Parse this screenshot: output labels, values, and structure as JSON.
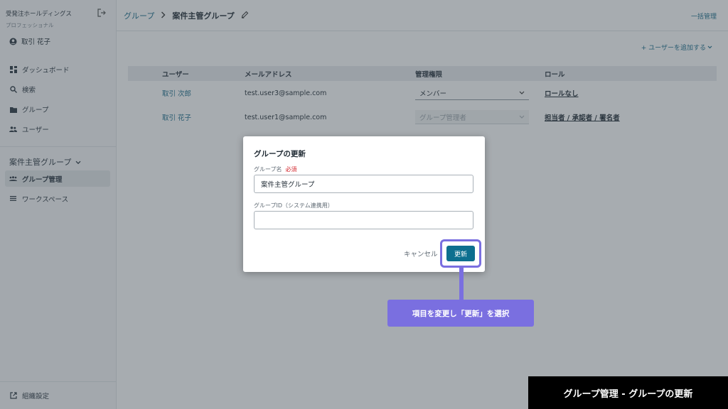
{
  "sidebar": {
    "org_name": "受発注ホールディングス",
    "plan": "プロフェッショナル",
    "user_name": "取引 花子",
    "nav_items": [
      {
        "label": "ダッシュボード",
        "icon": "dashboard-icon"
      },
      {
        "label": "検索",
        "icon": "search-icon"
      },
      {
        "label": "グループ",
        "icon": "folder-icon"
      },
      {
        "label": "ユーザー",
        "icon": "users-icon"
      }
    ],
    "group_header": "案件主管グループ",
    "subnav_items": [
      {
        "label": "グループ管理",
        "icon": "group-manage-icon",
        "active": true
      },
      {
        "label": "ワークスペース",
        "icon": "list-icon",
        "active": false
      }
    ],
    "settings_label": "組織設定"
  },
  "header": {
    "breadcrumb_parent": "グループ",
    "breadcrumb_current": "案件主管グループ",
    "bulk_manage": "一括管理"
  },
  "actions": {
    "add_user": "+ ユーザーを追加する"
  },
  "table": {
    "columns": [
      "ユーザー",
      "メールアドレス",
      "管理権限",
      "ロール"
    ],
    "rows": [
      {
        "user": "取引 次郎",
        "email": "test.user3@sample.com",
        "permission": "メンバー",
        "role": "ロールなし",
        "disabled": false
      },
      {
        "user": "取引 花子",
        "email": "test.user1@sample.com",
        "permission": "グループ管理者",
        "role": "担当者 / 承認者 / 署名者",
        "disabled": true
      }
    ]
  },
  "dialog": {
    "title": "グループの更新",
    "name_label": "グループ名",
    "required": "必須",
    "name_value": "案件主管グループ",
    "id_label": "グループID（システム連携用）",
    "id_value": "",
    "cancel": "キャンセル",
    "submit": "更新"
  },
  "annotation": {
    "callout": "項目を変更し「更新」を選択",
    "caption": "グループ管理 - グループの更新",
    "accent_color": "#7a6fe0"
  },
  "colors": {
    "link": "#1a6c8a",
    "primary_button": "#0d6f8f",
    "required": "#d3262c"
  }
}
